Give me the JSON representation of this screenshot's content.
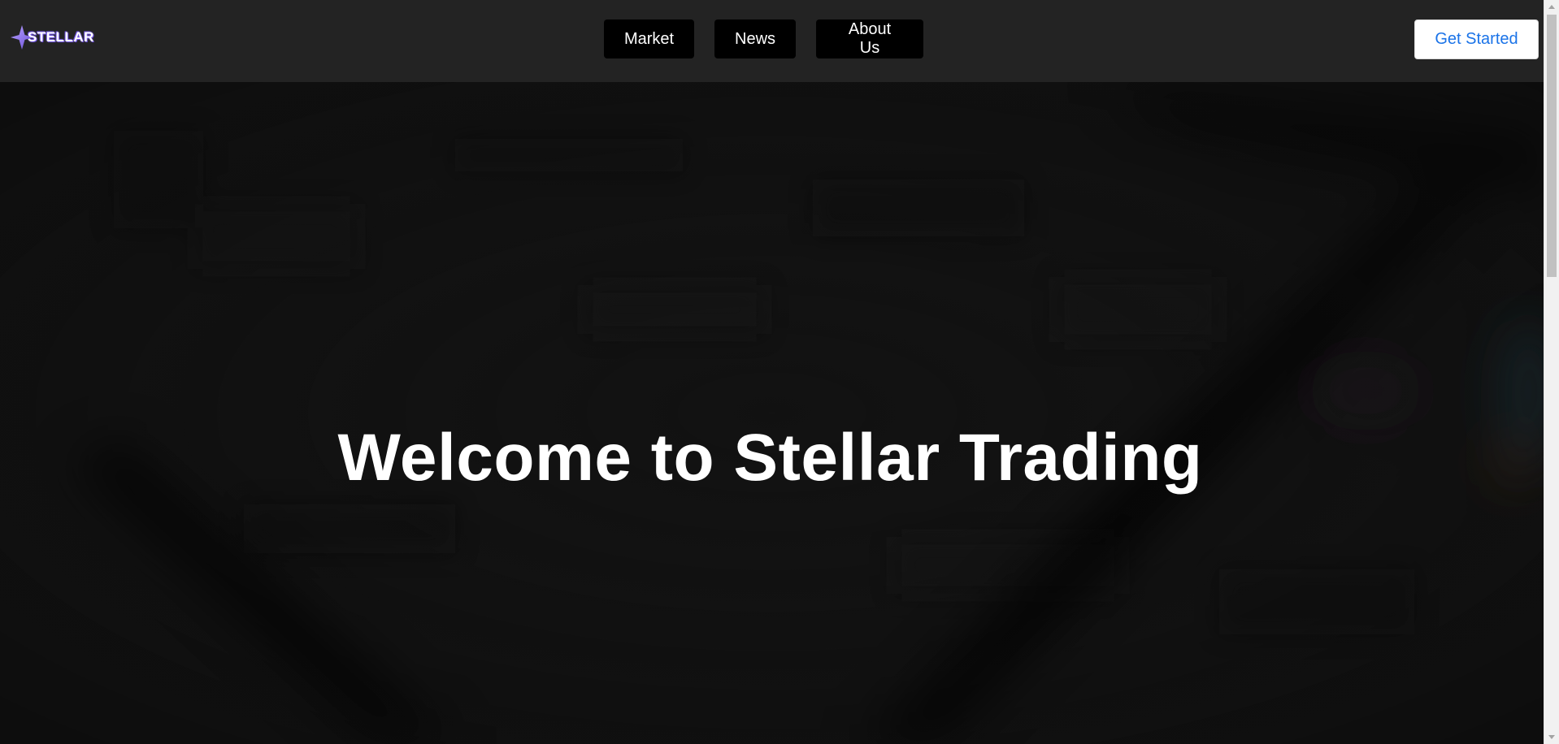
{
  "header": {
    "logo_text": "STELLAR",
    "nav": [
      {
        "label": "Market"
      },
      {
        "label": "News"
      },
      {
        "label": "About Us"
      }
    ],
    "cta_label": "Get Started"
  },
  "hero": {
    "title": "Welcome to Stellar Trading",
    "background": "blurred-trading-chart-image"
  },
  "colors": {
    "navbar_bg": "#232323",
    "nav_button_bg": "#000000",
    "cta_text": "#1a73e8",
    "logo_accent": "#8c6cff",
    "hero_bg": "#111111"
  },
  "icons": {
    "logo": "four-point-star-icon",
    "scroll_up": "triangle-up-icon",
    "scroll_down": "triangle-down-icon"
  }
}
